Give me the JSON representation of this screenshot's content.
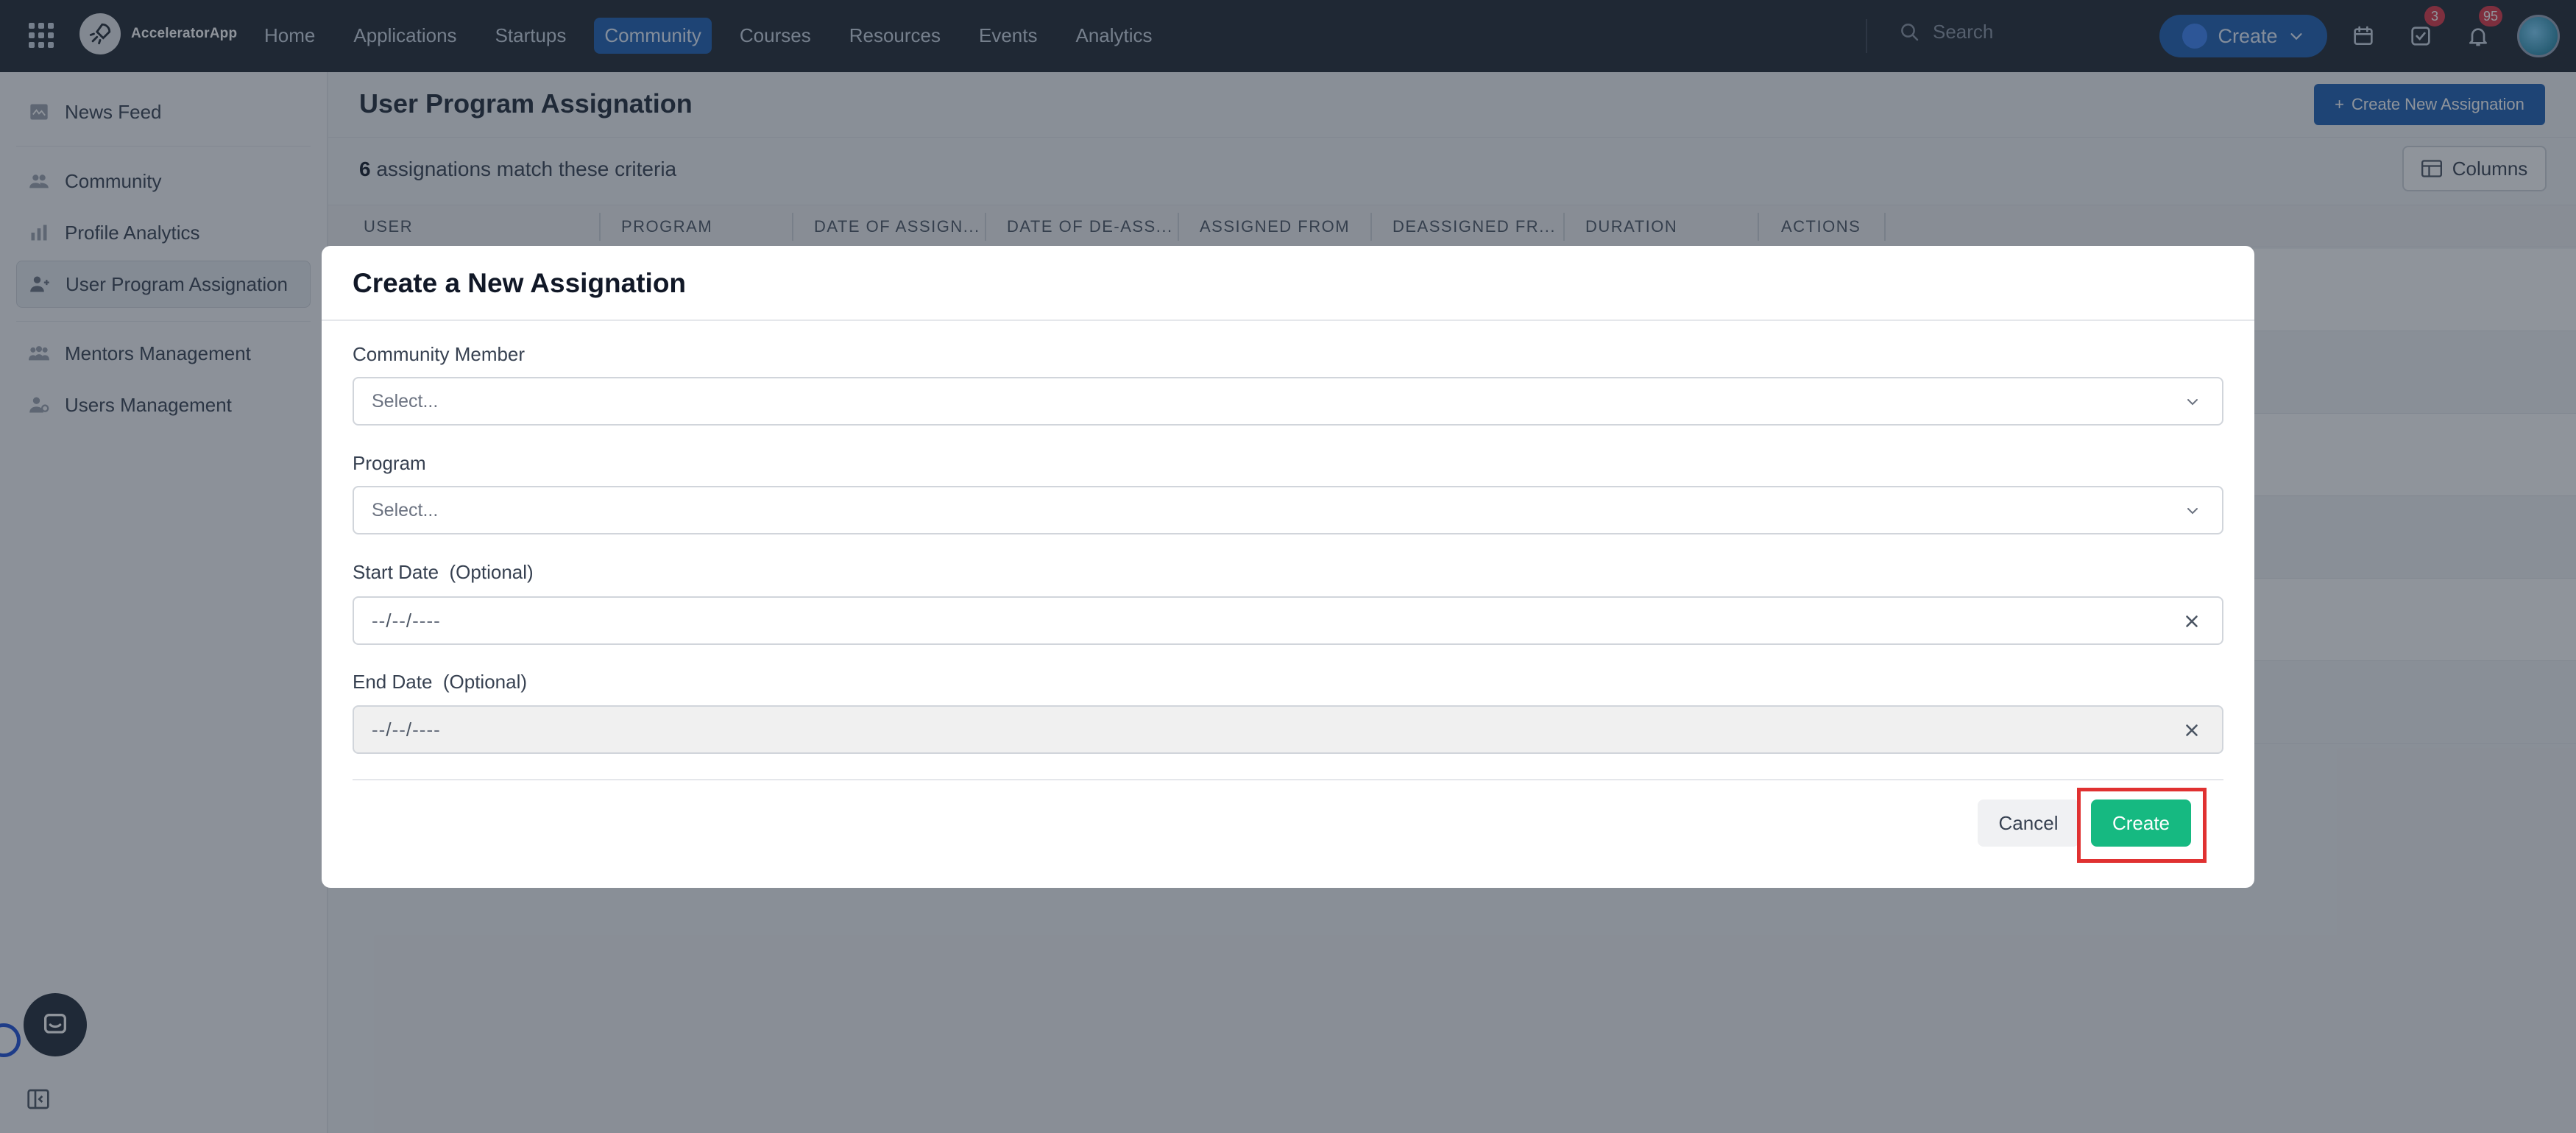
{
  "topbar": {
    "app_name": "AcceleratorApp",
    "nav": [
      "Home",
      "Applications",
      "Startups",
      "Community",
      "Courses",
      "Resources",
      "Events",
      "Analytics"
    ],
    "active_nav": "Community",
    "search_placeholder": "Search",
    "create_label": "Create",
    "tasks_badge": "3",
    "notifications_badge": "95"
  },
  "sidebar": {
    "items": [
      {
        "label": "News Feed",
        "icon": "news-feed-icon"
      },
      {
        "label": "Community",
        "icon": "community-icon"
      },
      {
        "label": "Profile Analytics",
        "icon": "bar-chart-icon"
      },
      {
        "label": "User Program Assignation",
        "icon": "user-assign-icon"
      },
      {
        "label": "Mentors Management",
        "icon": "mentors-icon"
      },
      {
        "label": "Users Management",
        "icon": "users-management-icon"
      }
    ],
    "active": "User Program Assignation"
  },
  "main": {
    "title": "User Program Assignation",
    "create_new_label": "Create New Assignation",
    "match_count": "6",
    "match_text": "assignations match these criteria",
    "columns_label": "Columns",
    "table_headers": [
      "USER",
      "PROGRAM",
      "DATE OF ASSIGN...",
      "DATE OF DE-ASS...",
      "ASSIGNED FROM",
      "DEASSIGNED FR...",
      "DURATION",
      "ACTIONS"
    ]
  },
  "modal": {
    "title": "Create a New Assignation",
    "fields": {
      "community_member": {
        "label": "Community Member",
        "placeholder": "Select..."
      },
      "program": {
        "label": "Program",
        "placeholder": "Select..."
      },
      "start_date": {
        "label": "Start Date",
        "optional": "(Optional)",
        "placeholder_parts": [
          "--",
          "/",
          "--",
          "/",
          "----"
        ]
      },
      "end_date": {
        "label": "End Date",
        "optional": "(Optional)",
        "placeholder_parts": [
          "--",
          "/",
          "--",
          "/",
          "----"
        ]
      }
    },
    "cancel_label": "Cancel",
    "confirm_label": "Create"
  },
  "colors": {
    "topbar_bg": "#1e2631",
    "primary": "#1d5fb3",
    "success": "#16b981",
    "highlight": "#e03131"
  }
}
